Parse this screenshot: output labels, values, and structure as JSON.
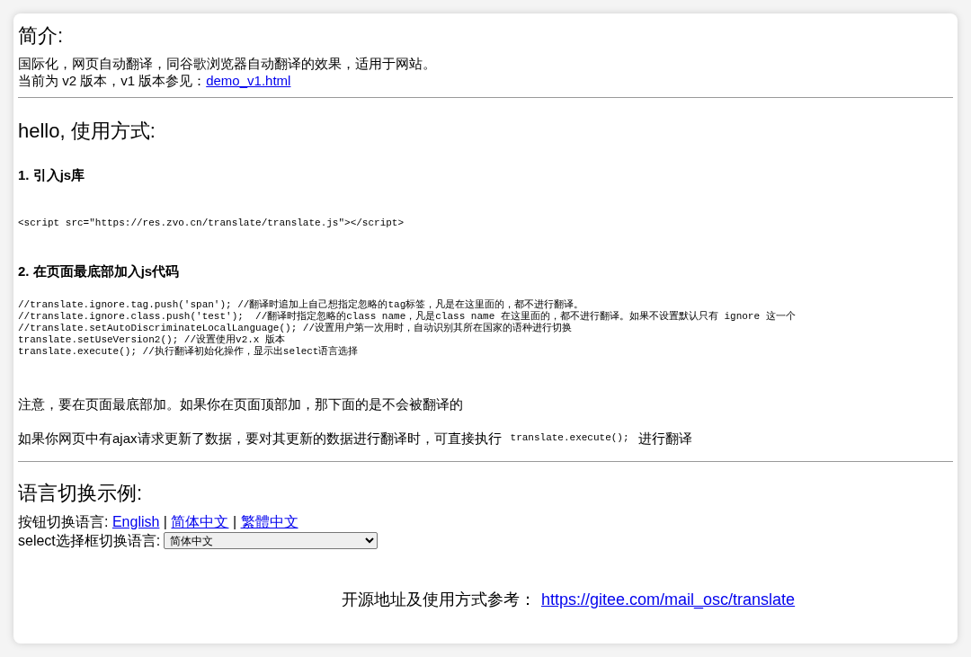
{
  "intro": {
    "title": "简介:",
    "description": "国际化，网页自动翻译，同谷歌浏览器自动翻译的效果，适用于网站。",
    "version_text": "当前为 v2 版本，v1 版本参见：",
    "version_link": "demo_v1.html"
  },
  "usage": {
    "title": "hello, 使用方式:",
    "steps": [
      {
        "title": "1. 引入js库",
        "code": [
          "<script src=\"https://res.zvo.cn/translate/translate.js\"></script>"
        ]
      },
      {
        "title": "2. 在页面最底部加入js代码",
        "code": [
          "//translate.ignore.tag.push('span'); //翻译时追加上自己想指定忽略的tag标签，凡是在这里面的，都不进行翻译。",
          "//translate.ignore.class.push('test');  //翻译时指定忽略的class name，凡是class name 在这里面的，都不进行翻译。如果不设置默认只有 ignore 这一个",
          "//translate.setAutoDiscriminateLocalLanguage(); //设置用户第一次用时，自动识别其所在国家的语种进行切换",
          "translate.setUseVersion2(); //设置使用v2.x 版本",
          "translate.execute(); //执行翻译初始化操作，显示出select语言选择"
        ]
      }
    ],
    "note": "注意，要在页面最底部加。如果你在页面顶部加，那下面的是不会被翻译的",
    "ajax_note": {
      "before": "如果你网页中有ajax请求更新了数据，要对其更新的数据进行翻译时，可直接执行",
      "code": "translate.execute();",
      "after": "进行翻译"
    }
  },
  "language_demo": {
    "title": "语言切换示例:",
    "buttons_label": "按钮切换语言:",
    "languages": [
      {
        "label": "English"
      },
      {
        "label": "简体中文"
      },
      {
        "label": "繁體中文"
      }
    ],
    "separators": [
      "|",
      "|"
    ],
    "select_label": "select选择框切换语言:",
    "select_value": "简体中文"
  },
  "footer": {
    "label": "开源地址及使用方式参考：",
    "link": "https://gitee.com/mail_osc/translate"
  }
}
